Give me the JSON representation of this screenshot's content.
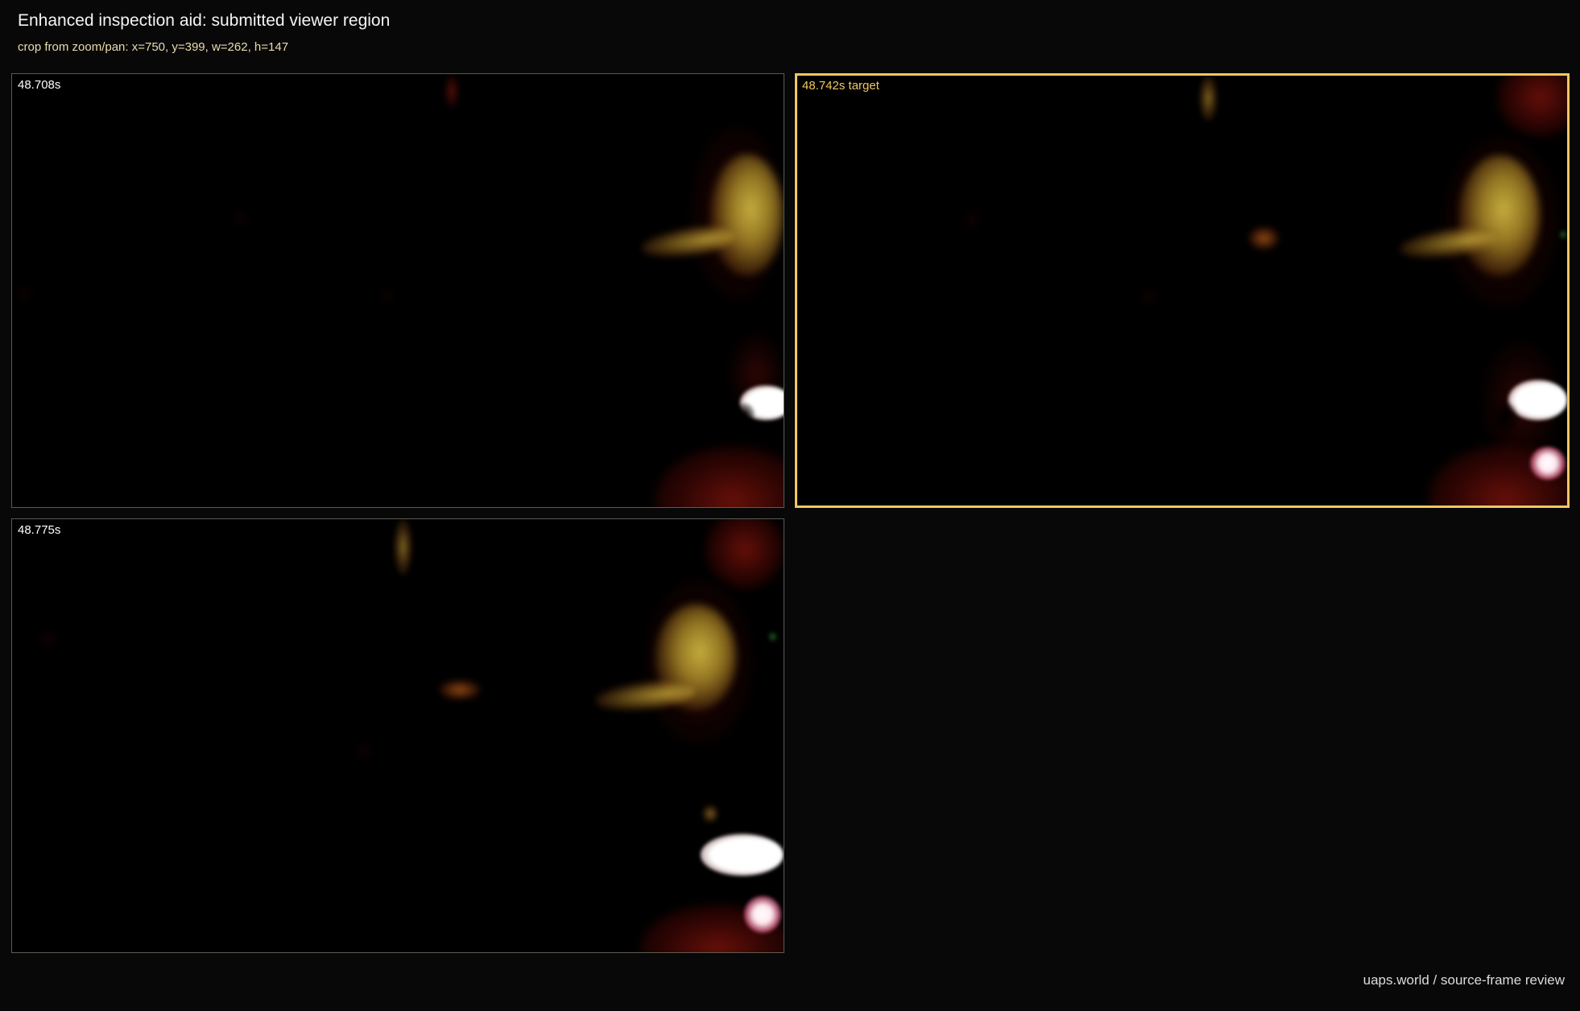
{
  "header": {
    "title": "Enhanced inspection aid: submitted viewer region",
    "subtitle": "crop from zoom/pan: x=750, y=399, w=262, h=147"
  },
  "frames": [
    {
      "label": "48.708s"
    },
    {
      "label": "48.742s target"
    },
    {
      "label": "48.775s"
    }
  ],
  "footer": {
    "text": "uaps.world / source-frame review"
  },
  "colors": {
    "background": "#080808",
    "target_accent": "#f0c860",
    "panel_border": "#5c5c52"
  }
}
